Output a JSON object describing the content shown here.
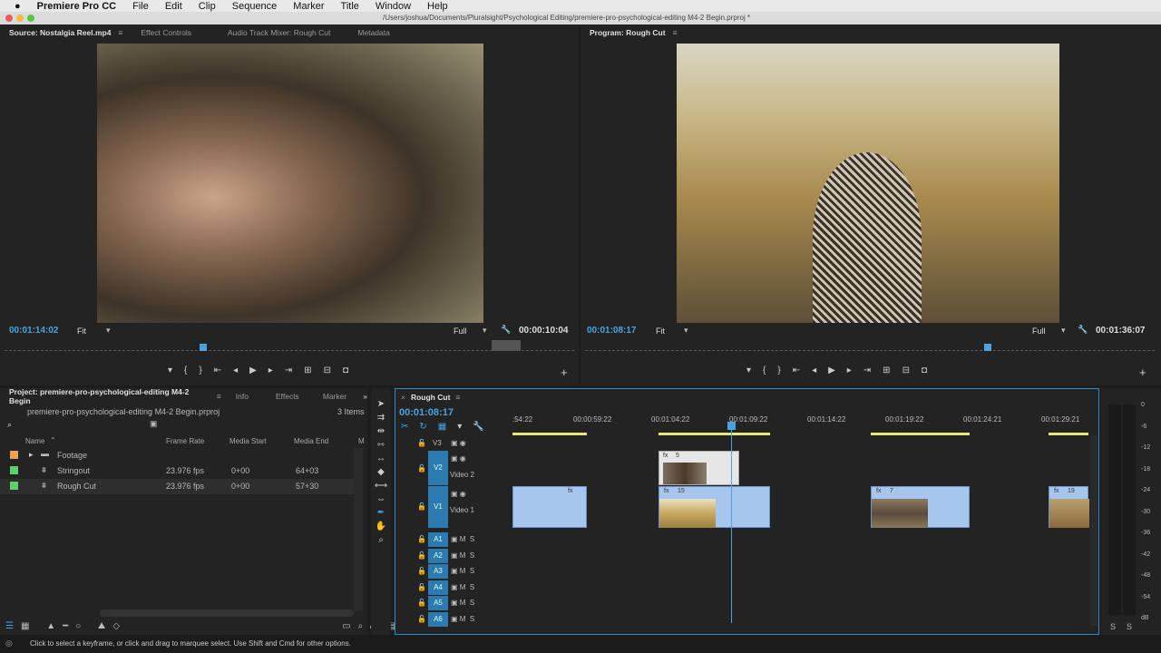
{
  "menubar": {
    "apple": "",
    "app": "Premiere Pro CC",
    "items": [
      "File",
      "Edit",
      "Clip",
      "Sequence",
      "Marker",
      "Title",
      "Window",
      "Help"
    ]
  },
  "titlebar": {
    "path": "/Users/joshua/Documents/Pluralsight/Psychological Editing/premiere-pro-psychological-editing M4-2 Begin.prproj *"
  },
  "source": {
    "tabs": [
      "Source: Nostalgia Reel.mp4",
      "Effect Controls",
      "Audio Track Mixer: Rough Cut",
      "Metadata"
    ],
    "timecode": "00:01:14:02",
    "zoom": "Fit",
    "quality": "Full",
    "duration": "00:00:10:04",
    "playhead_fraction": 0.35
  },
  "program": {
    "tab": "Program: Rough Cut",
    "timecode": "00:01:08:17",
    "zoom": "Fit",
    "quality": "Full",
    "duration": "00:01:36:07",
    "playhead_fraction": 0.71
  },
  "project": {
    "tabs": [
      "Project: premiere-pro-psychological-editing M4-2 Begin",
      "Info",
      "Effects",
      "Marker"
    ],
    "file": "premiere-pro-psychological-editing M4-2 Begin.prproj",
    "count": "3 Items",
    "columns": [
      "Name",
      "Frame Rate",
      "Media Start",
      "Media End",
      "M"
    ],
    "rows": [
      {
        "name": "Footage",
        "color": "#f0a050",
        "rate": "",
        "start": "",
        "end": ""
      },
      {
        "name": "Stringout",
        "color": "#5dd06a",
        "rate": "23.976 fps",
        "start": "0+00",
        "end": "64+03"
      },
      {
        "name": "Rough Cut",
        "color": "#5dd06a",
        "rate": "23.976 fps",
        "start": "0+00",
        "end": "57+30"
      }
    ]
  },
  "timeline": {
    "tab": "Rough Cut",
    "timecode": "00:01:08:17",
    "ruler": [
      ":54:22",
      "00:00:59:22",
      "00:01:04:22",
      "00:01:09:22",
      "00:01:14:22",
      "00:01:19:22",
      "00:01:24:21",
      "00:01:29:21"
    ],
    "video_tracks": [
      {
        "id": "V3",
        "name": ""
      },
      {
        "id": "V2",
        "name": "Video 2"
      },
      {
        "id": "V1",
        "name": "Video 1"
      }
    ],
    "audio_tracks": [
      "A1",
      "A2",
      "A3",
      "A4",
      "A5",
      "A6"
    ],
    "clips": {
      "v2": "5",
      "v1": [
        "",
        "15",
        "7",
        "19"
      ]
    }
  },
  "meter": {
    "scale": [
      "0",
      "-6",
      "-12",
      "-18",
      "-24",
      "-30",
      "-36",
      "-42",
      "-48",
      "-54",
      "dB"
    ],
    "solo": [
      "S",
      "S"
    ]
  },
  "status": "Click to select a keyframe, or click and drag to marquee select. Use Shift and Cmd for other options.",
  "colors": {
    "accent": "#4aa3df",
    "clip": "#a6c6ee",
    "render_bar": "#e6ea7a"
  }
}
